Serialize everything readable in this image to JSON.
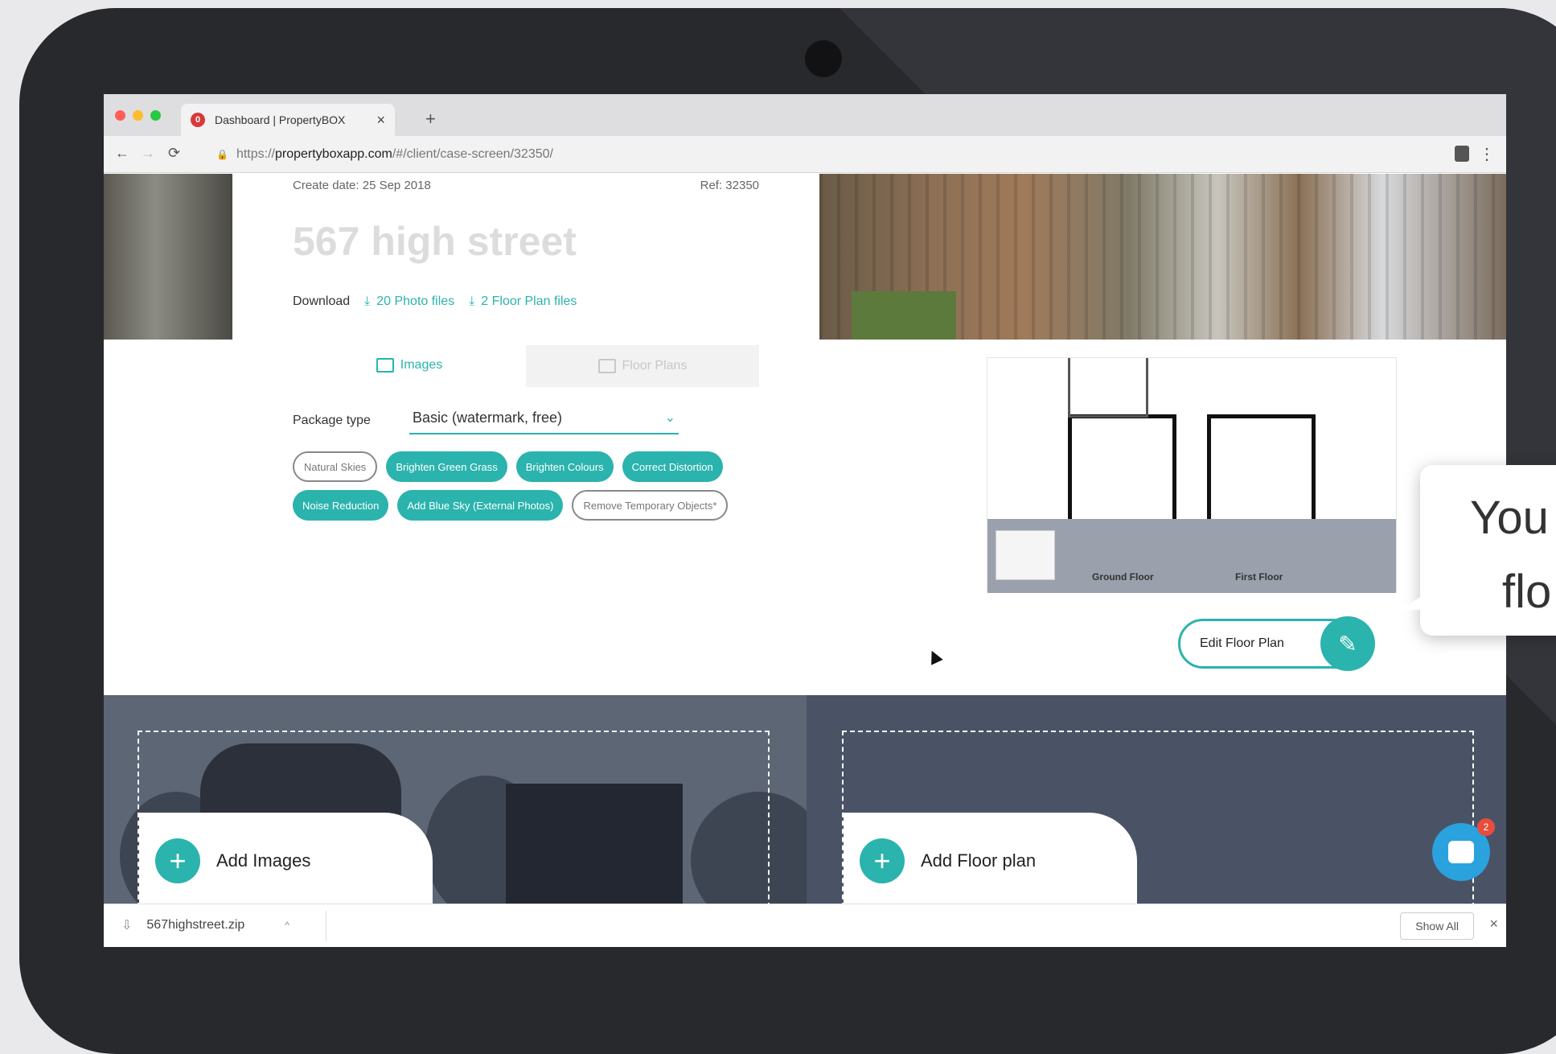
{
  "browser": {
    "tab_title": "Dashboard | PropertyBOX",
    "tab_close": "×",
    "new_tab": "+",
    "favicon_letter": "0",
    "url_prefix": "https://",
    "url_host": "propertyboxapp.com",
    "url_path": "/#/client/case-screen/32350/"
  },
  "case": {
    "create_date_label": "Create date:",
    "create_date": "25 Sep 2018",
    "ref": "Ref: 32350",
    "address": "567 high street"
  },
  "download": {
    "label": "Download",
    "photos": "20 Photo files",
    "plans": "2 Floor Plan files"
  },
  "tabs": {
    "images": "Images",
    "floor_plans": "Floor Plans"
  },
  "package": {
    "label": "Package type",
    "selected": "Basic (watermark, free)"
  },
  "options": [
    {
      "label": "Natural Skies",
      "selected": false
    },
    {
      "label": "Brighten Green Grass",
      "selected": true
    },
    {
      "label": "Brighten Colours",
      "selected": true
    },
    {
      "label": "Correct Distortion",
      "selected": true
    },
    {
      "label": "Noise Reduction",
      "selected": true
    },
    {
      "label": "Add Blue Sky (External Photos)",
      "selected": true
    },
    {
      "label": "Remove Temporary Objects*",
      "selected": false
    }
  ],
  "floorplan": {
    "ground_label": "Ground Floor",
    "first_label": "First Floor"
  },
  "edit_floor_plan": "Edit Floor Plan",
  "add_images": "Add Images",
  "add_floor_plan": "Add Floor plan",
  "downloads_bar": {
    "file": "567highstreet.zip",
    "show_all": "Show All",
    "close": "×"
  },
  "chat_badge": "2",
  "tooltip": {
    "line1": "You",
    "line2": "flo"
  },
  "colors": {
    "accent": "#2bb3ad",
    "chat": "#2aa2de",
    "badge": "#e74c3c"
  }
}
